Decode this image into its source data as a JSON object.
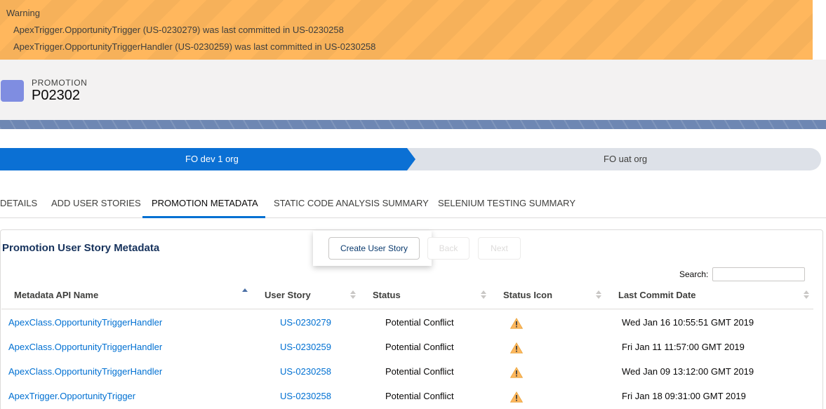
{
  "warning": {
    "title": "Warning",
    "lines": [
      "ApexTrigger.OpportunityTrigger (US-0230279) was last committed in US-0230258",
      "ApexTrigger.OpportunityTriggerHandler (US-0230259) was last committed in US-0230258"
    ],
    "color": "#ffb75d"
  },
  "record": {
    "type_label": "PROMOTION",
    "name": "P02302",
    "icon": "promotion-record-icon",
    "icon_color": "#7f8de1"
  },
  "path": {
    "stages": [
      {
        "label": "FO dev 1 org",
        "state": "active"
      },
      {
        "label": "FO uat org",
        "state": "incomplete"
      }
    ],
    "active_color": "#0b70d4"
  },
  "tabs": [
    {
      "label": "DETAILS"
    },
    {
      "label": "ADD USER STORIES"
    },
    {
      "label": "PROMOTION METADATA",
      "active": true
    },
    {
      "label": "STATIC CODE ANALYSIS SUMMARY"
    },
    {
      "label": "SELENIUM TESTING SUMMARY"
    }
  ],
  "metadata_card": {
    "title": "Promotion User Story Metadata",
    "buttons": {
      "create_user_story": "Create User Story",
      "back": "Back",
      "next": "Next"
    },
    "search": {
      "label": "Search:",
      "value": ""
    },
    "columns": [
      "Metadata API Name",
      "User Story",
      "Status",
      "Status Icon",
      "Last Commit Date"
    ],
    "sort": {
      "column": "Metadata API Name",
      "direction": "ascending"
    },
    "rows": [
      {
        "metadata": "ApexClass.OpportunityTriggerHandler",
        "user_story": "US-0230279",
        "status": "Potential Conflict",
        "status_icon": "warning-icon",
        "last_commit": "Wed Jan 16 10:55:51 GMT 2019"
      },
      {
        "metadata": "ApexClass.OpportunityTriggerHandler",
        "user_story": "US-0230259",
        "status": "Potential Conflict",
        "status_icon": "warning-icon",
        "last_commit": "Fri Jan 11 11:57:00 GMT 2019"
      },
      {
        "metadata": "ApexClass.OpportunityTriggerHandler",
        "user_story": "US-0230258",
        "status": "Potential Conflict",
        "status_icon": "warning-icon",
        "last_commit": "Wed Jan 09 13:12:00 GMT 2019"
      },
      {
        "metadata": "ApexTrigger.OpportunityTrigger",
        "user_story": "US-0230258",
        "status": "Potential Conflict",
        "status_icon": "warning-icon",
        "last_commit": "Fri Jan 18 09:31:00 GMT 2019"
      }
    ]
  },
  "colors": {
    "link": "#0070d2",
    "warning_icon": "#ffb75d",
    "tab_active_underline": "#0070d2"
  }
}
